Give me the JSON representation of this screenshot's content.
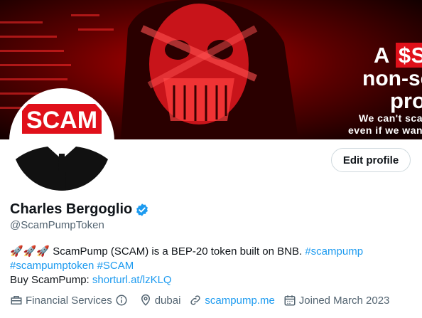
{
  "banner": {
    "line1_a": "A",
    "line1_b": "$SCAM",
    "line2": "non-scam",
    "line3": "project!",
    "line4": "We can't scam you",
    "line5": "even if we wanted to"
  },
  "avatar": {
    "text": "SCAM"
  },
  "edit_profile_label": "Edit profile",
  "profile": {
    "name": "Charles Bergoglio",
    "handle": "@ScamPumpToken"
  },
  "bio": {
    "rockets": "🚀🚀🚀",
    "text1": " ScamPump (SCAM) is a BEP-20 token built on BNB. ",
    "tag1": "#scampump",
    "tag2": "#scampumptoken",
    "tag3": "#SCAM",
    "text2": "Buy ScamPump: ",
    "link": "shorturl.at/lzKLQ"
  },
  "meta": {
    "category": "Financial Services",
    "location": "dubai",
    "website": "scampump.me",
    "joined": "Joined March 2023"
  },
  "colors": {
    "accent": "#1d9bf0",
    "banner_red": "#e0101a",
    "muted": "#536471"
  }
}
